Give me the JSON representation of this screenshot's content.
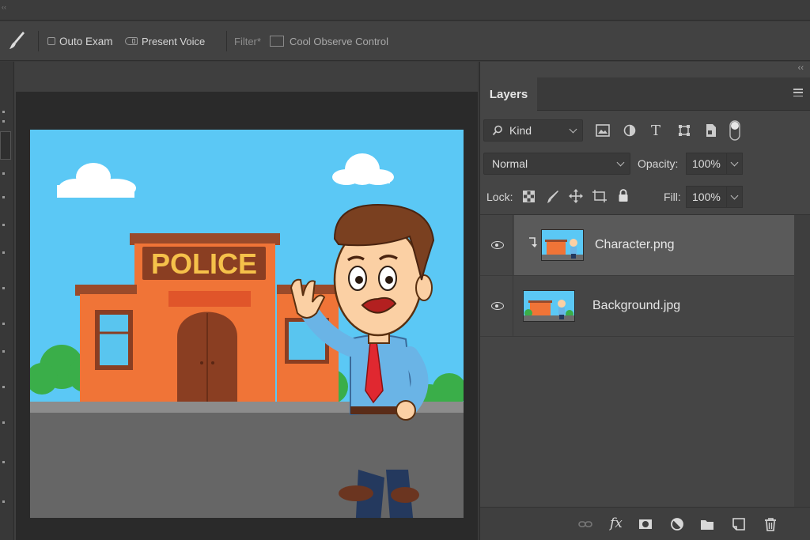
{
  "options_bar": {
    "auto_exam_label": "Outo Exam",
    "present_voice_label": "Present Voice",
    "filter_label": "Filter*",
    "cool_observe_label": "Cool Observe Control"
  },
  "panel": {
    "tab_label": "Layers",
    "kind_label": "Kind",
    "blend_mode": "Normal",
    "opacity_label": "Opacity:",
    "opacity_value": "100%",
    "lock_label": "Lock:",
    "fill_label": "Fill:",
    "fill_value": "100%",
    "filter_type_icon": "T",
    "fx_label": "fx"
  },
  "layers": [
    {
      "name": "Character.png",
      "visible": true,
      "selected": true,
      "clipped": true
    },
    {
      "name": "Background.jpg",
      "visible": true,
      "selected": false,
      "clipped": false
    }
  ],
  "artwork": {
    "sign_text": "POLICE"
  },
  "colors": {
    "sky": "#5bc8f5",
    "building": "#f07437",
    "road": "#666666",
    "panel_bg": "#454545"
  }
}
